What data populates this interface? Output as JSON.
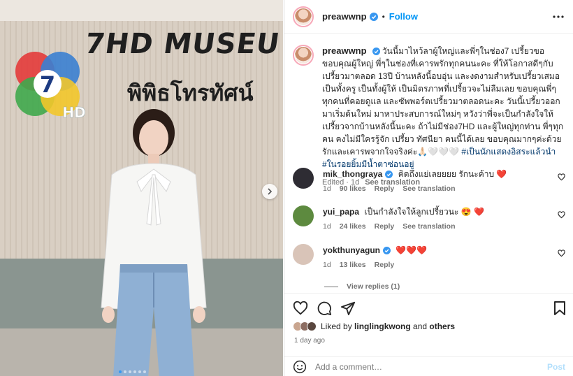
{
  "photo": {
    "sign_title": "7HD MUSEU",
    "sign_thai": "พิพิธโทรทัศน์",
    "channel_logo": "7",
    "channel_logo_sub": "HD",
    "next_icon": "chevron-right-icon",
    "carousel": {
      "count": 6,
      "active": 0
    }
  },
  "header": {
    "username": "preawwnp",
    "follow_label": "Follow",
    "dot": "•",
    "more_icon": "more-horizontal-icon"
  },
  "caption": {
    "username": "preawwnp",
    "text": "วันนี้มาไหว้ลาผู้ใหญ่และพี่ๆในช่อง7 เปรี้ยวขอขอบคุณผู้ใหญ่ พี่ๆในช่องที่เคารพรักทุกคนนะคะ ที่ให้โอกาสดีๆกับเปรี้ยวมาตลอด 13ปี บ้านหลังนี้อบอุ่น และงดงามสำหรับเปรี้ยวเสมอ เป็นทั้งครู เป็นทั้งผู้ให้ เป็นมิตรภาพที่เปรี้ยวจะไม่ลืมเลย ขอบคุณพี่ๆทุกคนที่คอยดูแล และซัพพอร์ตเปรี้ยวมาตลอดนะคะ วันนี้เปรี้ยวออกมาเริ่มต้นใหม่ มาหาประสบการณ์ใหม่ๆ หวังว่าพี่จะเป็นกำลังใจให้เปรี้ยวจากบ้านหลังนี้นะคะ ถ้าไม่มีช่อง7HD และผู้ใหญ่ทุกท่าน พี่ๆทุกคน คงไม่มีใครรู้จัก เปรี้ยว ทัศนียา คนนี้ได้เลย ขอบคุณมากๆค่ะด้วยรักและเคารพจากใจจริงค่ะ🙏🏻🤍🤍🤍 ",
    "hashtags": "#เป็นนักแสดงอิสระแล้วนำ #ในรอยยิ้มมีน้ำตาซ่อนอยู่",
    "edited": "Edited · 1d",
    "see_translation": "See translation"
  },
  "comments": [
    {
      "username": "mik_thongraya",
      "verified": true,
      "text": "คิดถึงแย่เลยยยย รักนะค้าบ ❤️",
      "age": "1d",
      "likes": "90 likes",
      "reply": "Reply",
      "translation": "See translation",
      "avatar_color": "#2e2c33"
    },
    {
      "username": "yui_papa",
      "verified": false,
      "text": "เป็นกำลังใจให้ลูกเปรี้ยวนะ 😍 ❤️",
      "age": "1d",
      "likes": "24 likes",
      "reply": "Reply",
      "translation": "See translation",
      "avatar_color": "#5d8a3f"
    },
    {
      "username": "yokthunyagun",
      "verified": true,
      "text": "❤️❤️❤️",
      "age": "1d",
      "likes": "13 likes",
      "reply": "Reply",
      "translation": "",
      "avatar_color": "#d9c4b8"
    }
  ],
  "view_replies": "View replies (1)",
  "actions": {
    "like_icon": "heart-icon",
    "comment_icon": "comment-icon",
    "share_icon": "share-icon",
    "save_icon": "bookmark-icon"
  },
  "likes": {
    "prefix": "Liked by ",
    "user": "linglingkwong",
    "and": " and ",
    "others": "others"
  },
  "posted_ago": "1 day ago",
  "add_comment": {
    "placeholder": "Add a comment…",
    "post_label": "Post",
    "emoji_icon": "emoji-icon"
  },
  "colors": {
    "accent": "#0095f6",
    "verified": "#3897f0",
    "heart": "#ed4956",
    "muted": "#737373"
  }
}
